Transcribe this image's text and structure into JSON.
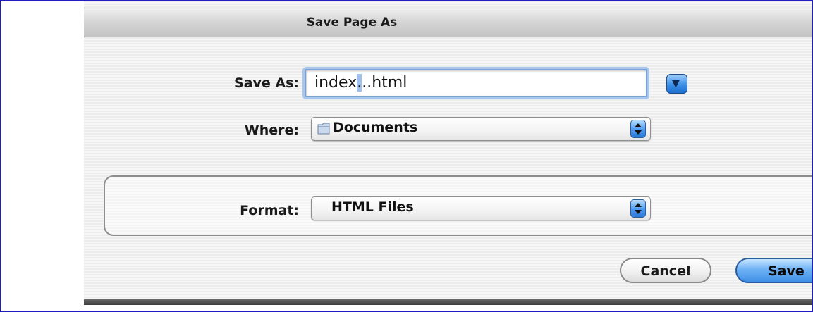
{
  "window": {
    "title": "Save Page As"
  },
  "save_as": {
    "label": "Save As:",
    "value_before": "index",
    "value_selected": ".",
    "value_after": "..html"
  },
  "where": {
    "label": "Where:",
    "selected": "Documents",
    "icon": "folder-icon"
  },
  "format": {
    "label": "Format:",
    "selected": "HTML Files"
  },
  "buttons": {
    "cancel": "Cancel",
    "save": "Save"
  },
  "colors": {
    "accent": "#3f8fe6",
    "focus_ring": "#a9c6ec",
    "frame_border": "#1f1fbf"
  }
}
